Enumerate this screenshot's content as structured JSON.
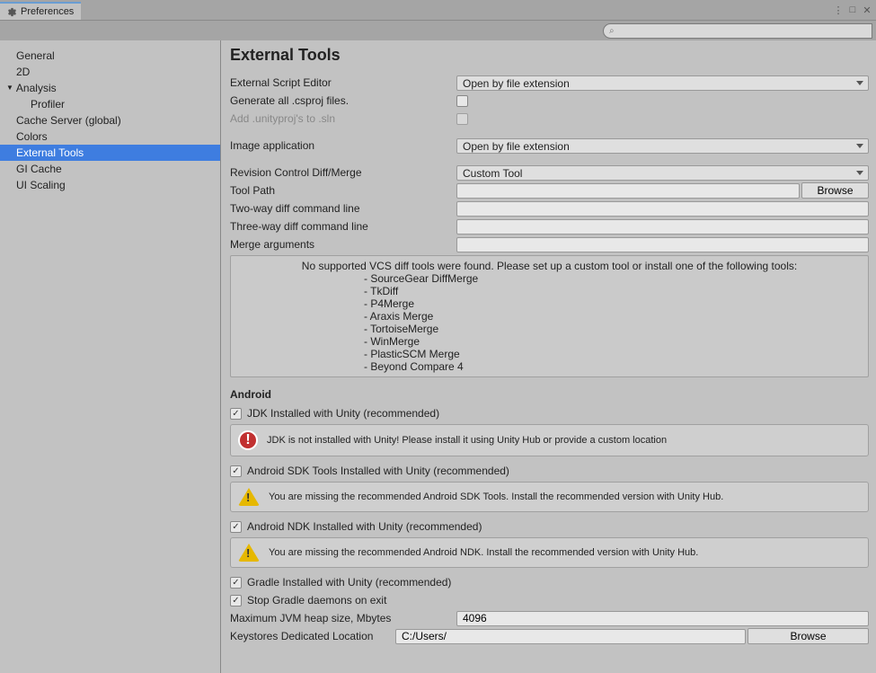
{
  "window": {
    "title": "Preferences"
  },
  "search": {
    "placeholder": ""
  },
  "sidebar": {
    "items": [
      {
        "label": "General"
      },
      {
        "label": "2D"
      },
      {
        "label": "Analysis",
        "expandable": true
      },
      {
        "label": "Profiler",
        "child": true
      },
      {
        "label": "Cache Server (global)"
      },
      {
        "label": "Colors"
      },
      {
        "label": "External Tools",
        "selected": true
      },
      {
        "label": "GI Cache"
      },
      {
        "label": "UI Scaling"
      }
    ]
  },
  "content": {
    "title": "External Tools",
    "externalScriptEditor": {
      "label": "External Script Editor",
      "value": "Open by file extension"
    },
    "generateCsproj": {
      "label": "Generate all .csproj files.",
      "checked": false
    },
    "addUnityproj": {
      "label": "Add .unityproj's to .sln",
      "checked": false,
      "disabled": true
    },
    "imageApplication": {
      "label": "Image application",
      "value": "Open by file extension"
    },
    "revisionControl": {
      "label": "Revision Control Diff/Merge",
      "value": "Custom Tool"
    },
    "toolPath": {
      "label": "Tool Path",
      "value": "",
      "browse": "Browse"
    },
    "twoWayDiff": {
      "label": "Two-way diff command line",
      "value": ""
    },
    "threeWayDiff": {
      "label": "Three-way diff command line",
      "value": ""
    },
    "mergeArgs": {
      "label": "Merge arguments",
      "value": ""
    },
    "vcsInfo": {
      "header": "No supported VCS diff tools were found. Please set up a custom tool or install one of the following tools:",
      "tools": [
        "- SourceGear DiffMerge",
        "- TkDiff",
        "- P4Merge",
        "- Araxis Merge",
        "- TortoiseMerge",
        "- WinMerge",
        "- PlasticSCM Merge",
        "- Beyond Compare 4"
      ]
    },
    "android": {
      "header": "Android",
      "jdk": {
        "label": "JDK Installed with Unity (recommended)",
        "checked": true,
        "alert": "JDK is not installed with Unity! Please install it using Unity Hub or provide a custom location",
        "alertType": "error"
      },
      "sdk": {
        "label": "Android SDK Tools Installed with Unity (recommended)",
        "checked": true,
        "alert": "You are missing the recommended Android SDK Tools. Install the recommended version with Unity Hub.",
        "alertType": "warning"
      },
      "ndk": {
        "label": "Android NDK Installed with Unity (recommended)",
        "checked": true,
        "alert": "You are missing the recommended Android NDK. Install the recommended version with Unity Hub.",
        "alertType": "warning"
      },
      "gradle": {
        "label": "Gradle Installed with Unity (recommended)",
        "checked": true
      },
      "stopGradle": {
        "label": "Stop Gradle daemons on exit",
        "checked": true
      },
      "jvmHeap": {
        "label": "Maximum JVM heap size, Mbytes",
        "value": "4096"
      },
      "keystore": {
        "label": "Keystores Dedicated Location",
        "value": "C:/Users/",
        "browse": "Browse"
      }
    }
  }
}
